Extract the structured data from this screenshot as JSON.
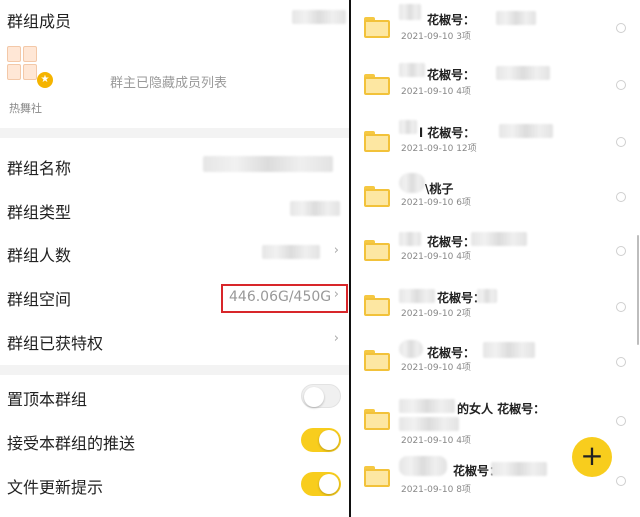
{
  "left": {
    "members_label": "群组成员",
    "members_org": "热舞社",
    "hidden_text": "群主已隐藏成员列表",
    "rows": [
      {
        "label": "群组名称"
      },
      {
        "label": "群组类型"
      },
      {
        "label": "群组人数"
      },
      {
        "label": "群组空间",
        "value": "446.06G/450G"
      },
      {
        "label": "群组已获特权"
      }
    ],
    "toggles": [
      {
        "label": "置顶本群组",
        "state": "off"
      },
      {
        "label": "接受本群组的推送",
        "state": "on"
      },
      {
        "label": "文件更新提示",
        "state": "on"
      }
    ]
  },
  "right": {
    "files": [
      {
        "title_suffix": "花椒号：",
        "date": "2021-09-10",
        "count": "3项"
      },
      {
        "title_suffix": "花椒号：",
        "date": "2021-09-10",
        "count": "4项"
      },
      {
        "title_suffix": "l 花椒号：",
        "date": "2021-09-10",
        "count": "12项"
      },
      {
        "title_suffix": "\\桃子",
        "date": "2021-09-10",
        "count": "6项"
      },
      {
        "title_suffix": "花椒号：",
        "date": "2021-09-10",
        "count": "4项"
      },
      {
        "title_suffix": "花椒号：",
        "date": "2021-09-10",
        "count": "2项"
      },
      {
        "title_suffix": "花椒号：",
        "date": "2021-09-10",
        "count": "4项"
      },
      {
        "title_suffix": "的女人 花椒号：",
        "date": "2021-09-10",
        "count": "4项"
      },
      {
        "title_suffix": "花椒号：",
        "date": "2021-09-10",
        "count": "8项"
      }
    ],
    "fab_symbol": "+"
  }
}
